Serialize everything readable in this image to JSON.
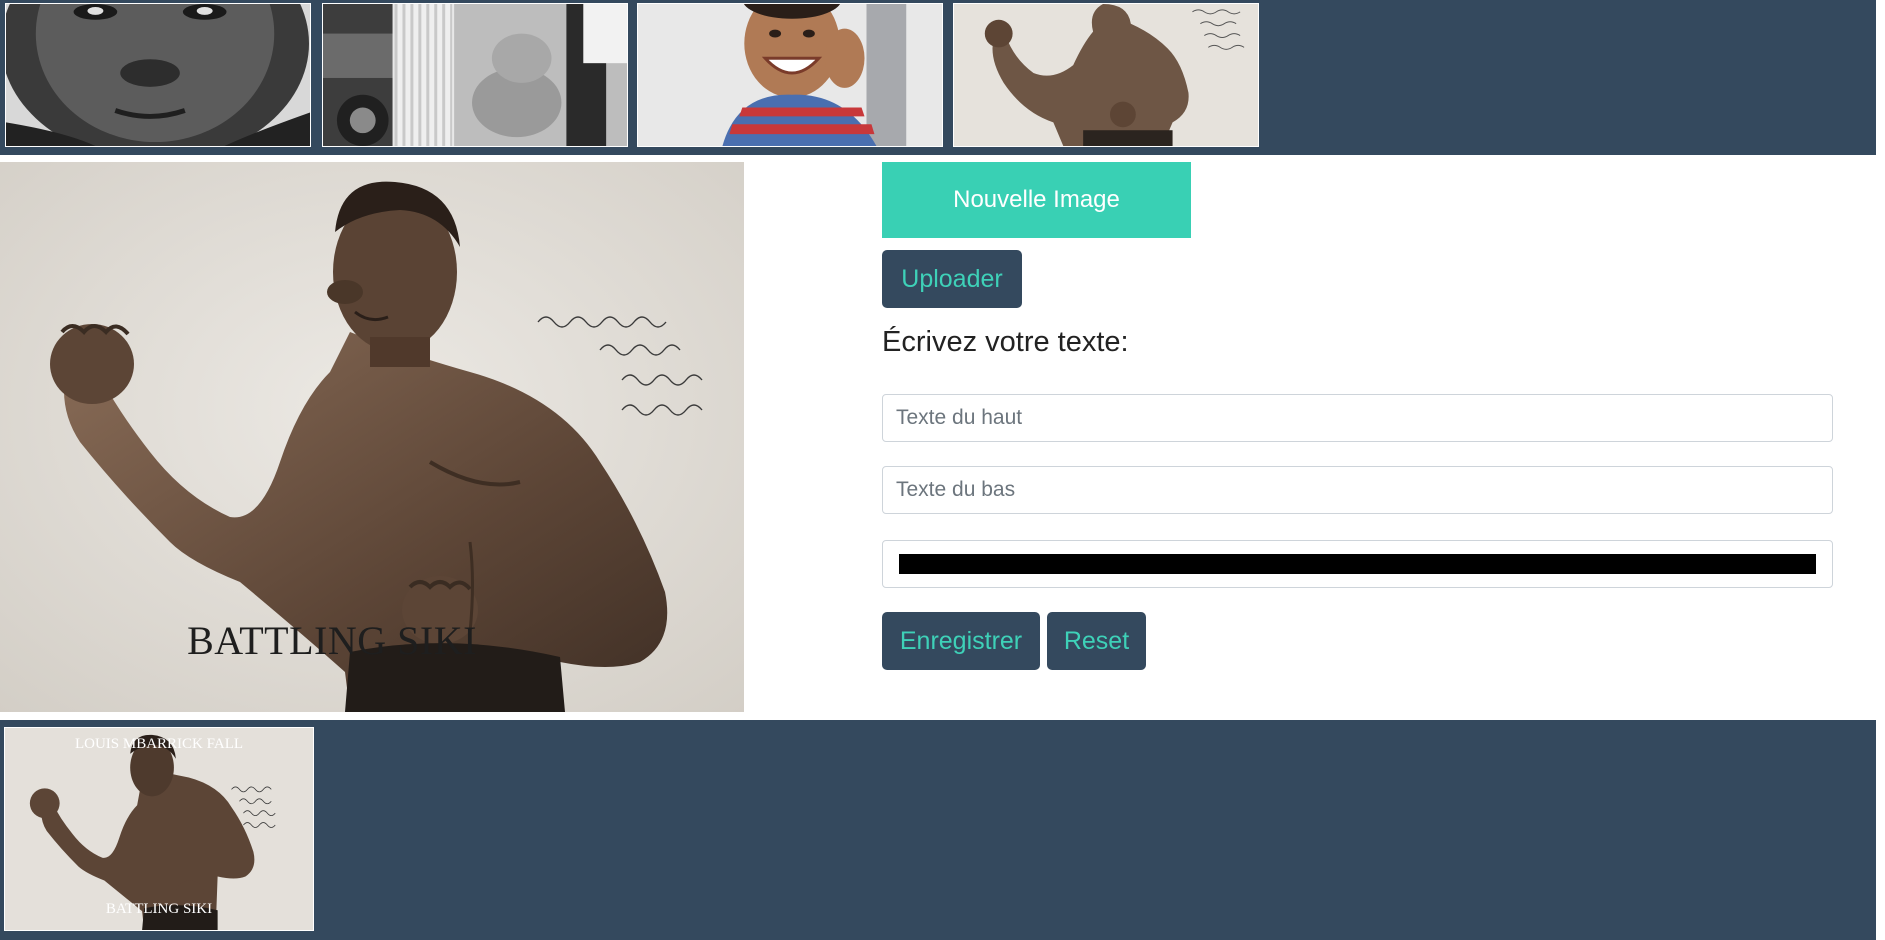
{
  "gallery": {
    "images": [
      {
        "name": "portrait-close-up-bw"
      },
      {
        "name": "woman-with-car-bw"
      },
      {
        "name": "smiling-boy"
      },
      {
        "name": "boxer-battling-siki"
      }
    ]
  },
  "editor": {
    "top_text": "",
    "bottom_text": "BATTLING SIKI"
  },
  "form": {
    "new_image_label": "Nouvelle Image",
    "upload_label": "Uploader",
    "heading": "Écrivez votre texte:",
    "top_placeholder": "Texte du haut",
    "bottom_placeholder": "Texte du bas",
    "color_value": "#000000",
    "save_label": "Enregistrer",
    "reset_label": "Reset"
  },
  "saved": {
    "items": [
      {
        "top_text": "LOUIS MBARRICK FALL",
        "bottom_text": "BATTLING SIKI"
      }
    ]
  },
  "colors": {
    "strip_bg": "#34495e",
    "accent": "#39d0b4",
    "accent_text": "#3ed1b8"
  }
}
